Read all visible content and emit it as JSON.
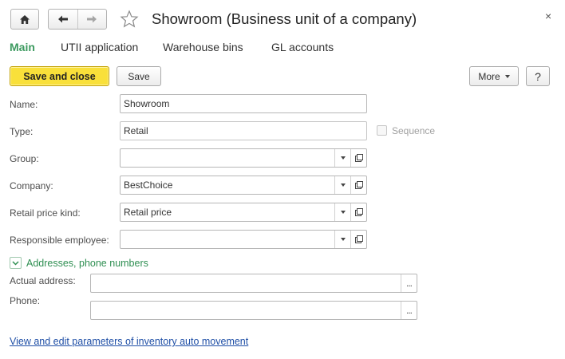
{
  "window": {
    "title": "Showroom (Business unit of a company)",
    "close_glyph": "×"
  },
  "icons": {
    "home": "home-icon",
    "back": "arrow-left-icon",
    "forward": "arrow-right-icon",
    "favorite": "star-icon",
    "close": "close-icon"
  },
  "tabs": [
    {
      "label": "Main",
      "active": true
    },
    {
      "label": "UTII application"
    },
    {
      "label": "Warehouse bins"
    },
    {
      "label": "GL accounts"
    }
  ],
  "toolbar": {
    "save_and_close": "Save and close",
    "save": "Save",
    "more": "More",
    "help": "?"
  },
  "form": {
    "name": {
      "label": "Name:",
      "value": "Showroom"
    },
    "type": {
      "label": "Type:",
      "value": "Retail"
    },
    "sequence": {
      "label": "Sequence",
      "checked": false
    },
    "group": {
      "label": "Group:",
      "value": ""
    },
    "company": {
      "label": "Company:",
      "value": "BestChoice"
    },
    "retail_price_kind": {
      "label": "Retail price kind:",
      "value": "Retail price"
    },
    "responsible_employee": {
      "label": "Responsible employee:",
      "value": ""
    }
  },
  "addresses": {
    "title": "Addresses, phone numbers",
    "actual_address": {
      "label": "Actual address:",
      "value": ""
    },
    "phone": {
      "label": "Phone:",
      "value": ""
    },
    "dots": "..."
  },
  "link": {
    "text": "View and edit parameters of inventory auto movement"
  },
  "colors": {
    "accent_green": "#3c9a5f",
    "primary_button": "#f9e03a",
    "link_blue": "#1f4fa6"
  }
}
